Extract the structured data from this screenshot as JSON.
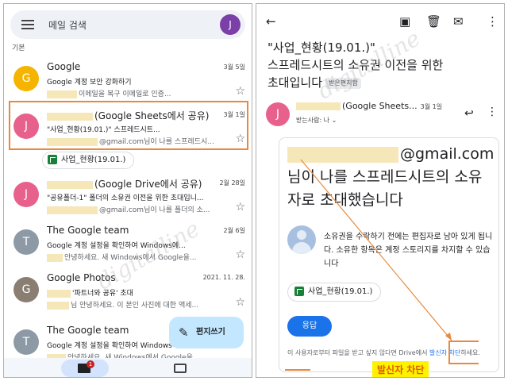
{
  "left": {
    "search_placeholder": "메일 검색",
    "account_initial": "J",
    "section_label": "기본",
    "emails": [
      {
        "initial": "G",
        "avatar_color": "#f5b400",
        "sender": "Google",
        "date": "3월 5일",
        "subject": "Google 계정 보안 강화하기",
        "snippet": "이메일을 복구 이메일로 인증..."
      },
      {
        "initial": "J",
        "avatar_color": "#e8618c",
        "sender": "(Google Sheets에서 공유)",
        "date": "3월 1일",
        "subject": "\"사업_현황(19.01.)\" 스프레드시트...",
        "snippet": "@gmail.com님이 나를 스프레드시..."
      },
      {
        "initial": "J",
        "avatar_color": "#e8618c",
        "sender": "(Google Drive에서 공유)",
        "date": "2월 28일",
        "subject": "\"공유폴더-1\" 폴더의 소유권 이전을 위한 초대입니...",
        "snippet": "@gmail.com님이 나를 폴더의 소..."
      },
      {
        "initial": "T",
        "avatar_color": "#8d9aa6",
        "sender": "The Google team",
        "date": "2월 6일",
        "subject": "Google 계정 설정을 확인하여 Windows에...",
        "snippet": "안녕하세요. 새 Windows에서 Google을..."
      },
      {
        "initial": "G",
        "avatar_color": "#8a7d72",
        "sender": "Google Photos",
        "date": "2021. 11. 28.",
        "subject": "'파트너와 공유' 초대",
        "snippet": "님 안녕하세요. 이 본인 사진에 대한 액세..."
      },
      {
        "initial": "T",
        "avatar_color": "#8d9aa6",
        "sender": "The Google team",
        "date": "",
        "subject": "Google 계정 설정을 확인하여 Windows에...",
        "snippet": "안녕하세요. 새 Windows에서 Google을..."
      }
    ],
    "attachment_chip": "사업_현황(19.01.)",
    "compose_label": "편지쓰기",
    "mail_badge": "1"
  },
  "right": {
    "title_line1": "\"사업_현황(19.01.)\"",
    "title_line2": "스프레드시트의 소유권 이전을 위한",
    "title_line3": "초대입니다",
    "inbox_tag": "받은편지함",
    "sender_initial": "J",
    "sender": "(Google Sheets...",
    "date": "3월 1일",
    "to_label": "받는사람: 나 ⌄",
    "big_text": "@gmail.com님이 나를 스프레드시트의 소유자로 초대했습니다",
    "info_text": "소유권을 수락하기 전에는 편집자로 남아 있게 됩니다. 소유한 항목은 계정 스토리지를 차지할 수 있습니다",
    "chip_label": "사업_현황(19.01.)",
    "reply_button": "응답",
    "footer_text": "이 사용자로부터 파일을 받고 싶지 않다면 Drive에서 ",
    "footer_link": "발신자 차단",
    "footer_end": "하세요.",
    "callout": "발신자 차단"
  },
  "watermark": "digitalline",
  "colors": {
    "accent_orange": "#e8893b",
    "callout_bg": "#fff200",
    "blue": "#1a73e8"
  }
}
